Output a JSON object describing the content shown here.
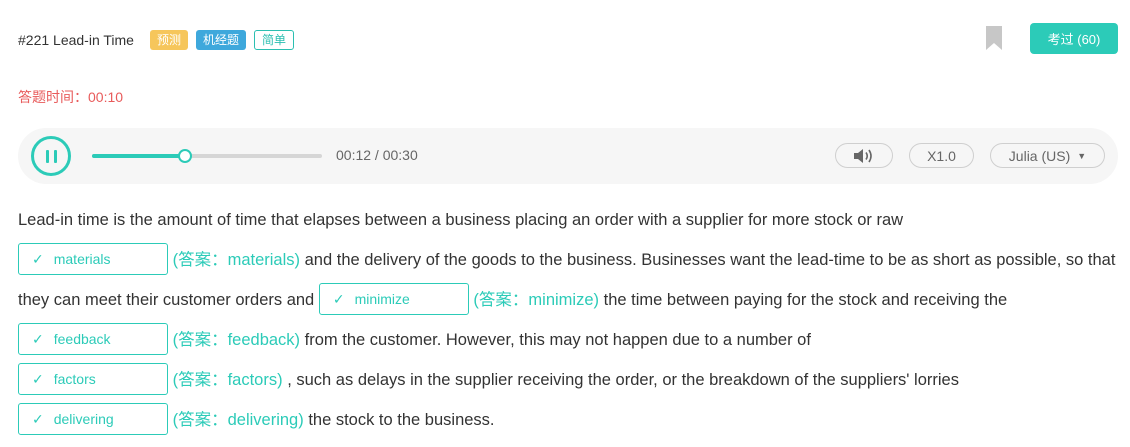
{
  "header": {
    "title": "#221 Lead-in Time",
    "tags": [
      "预测",
      "机经题",
      "简单"
    ],
    "exam_button": "考过 (60)"
  },
  "timer": {
    "text": "答题时间：00:10"
  },
  "player": {
    "progress": 0.4,
    "time": "00:12 / 00:30",
    "speed": "X1.0",
    "voice": "Julia (US)",
    "caret": "▼"
  },
  "passage": {
    "check_mark": "✓",
    "segments": {
      "s1": "Lead-in time is the amount of time that elapses between a business placing an order with a supplier for more stock or raw",
      "s2": "and the delivery of the goods to the business. Businesses want the lead-time to be as short as possible, so that they can meet their customer orders and",
      "s3": "the time between paying for the stock and receiving the",
      "s4": "from the customer. However, this may not happen due to a number of",
      "s5": ", such as delays in the supplier receiving the order, or the breakdown of the suppliers' lorries",
      "s6": "the stock to the business."
    },
    "blanks": [
      {
        "value": "materials",
        "answer": "(答案：materials)"
      },
      {
        "value": "minimize",
        "answer": "(答案：minimize)"
      },
      {
        "value": "feedback",
        "answer": "(答案：feedback)"
      },
      {
        "value": "factors",
        "answer": "(答案：factors)"
      },
      {
        "value": "delivering",
        "answer": "(答案：delivering)"
      }
    ]
  },
  "colors": {
    "accent": "#2ccbb8",
    "timer": "#e85b5b",
    "tag_predict": "#f6c65b",
    "tag_jijing": "#3ea8dc"
  }
}
